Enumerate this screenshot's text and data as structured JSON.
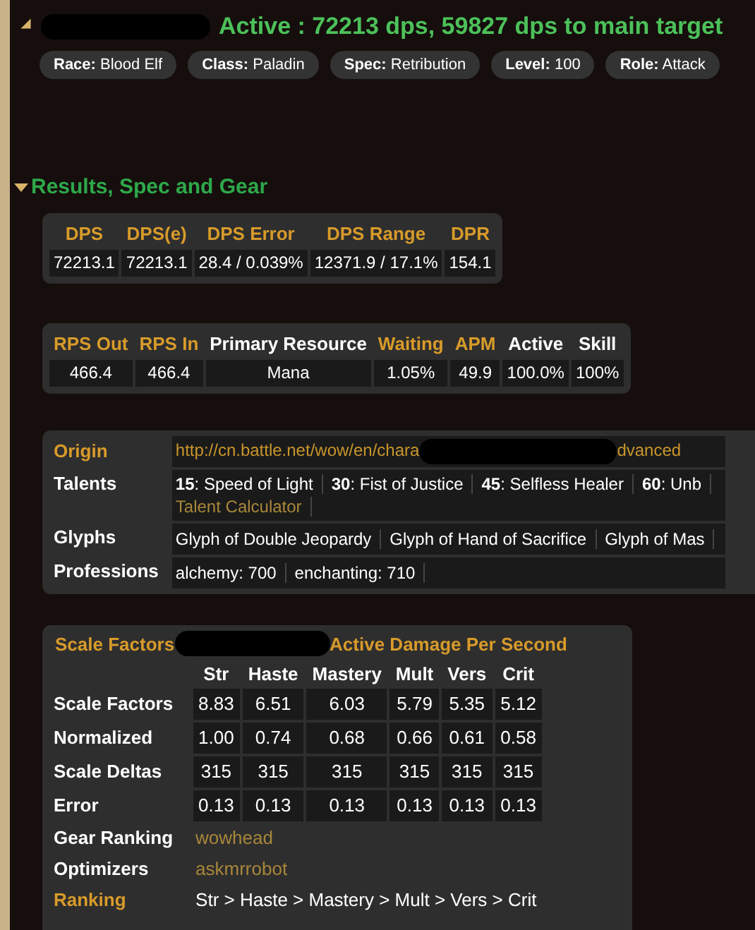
{
  "header": {
    "title": "Active : 72213 dps, 59827 dps to main target",
    "tags": [
      {
        "label": "Race:",
        "value": "Blood Elf"
      },
      {
        "label": "Class:",
        "value": "Paladin"
      },
      {
        "label": "Spec:",
        "value": "Retribution"
      },
      {
        "label": "Level:",
        "value": "100"
      },
      {
        "label": "Role:",
        "value": "Attack"
      }
    ]
  },
  "section": {
    "title": "Results, Spec and Gear",
    "expanded": true
  },
  "dps_table": {
    "columns": [
      {
        "label": "DPS",
        "kind": "metric"
      },
      {
        "label": "DPS(e)",
        "kind": "metric"
      },
      {
        "label": "DPS Error",
        "kind": "metric"
      },
      {
        "label": "DPS Range",
        "kind": "metric"
      },
      {
        "label": "DPR",
        "kind": "metric"
      }
    ],
    "values": [
      "72213.1",
      "72213.1",
      "28.4 / 0.039%",
      "12371.9 / 17.1%",
      "154.1"
    ]
  },
  "resource_table": {
    "columns": [
      {
        "label": "RPS Out",
        "kind": "metric"
      },
      {
        "label": "RPS In",
        "kind": "metric"
      },
      {
        "label": "Primary Resource",
        "kind": "plain"
      },
      {
        "label": "Waiting",
        "kind": "metric"
      },
      {
        "label": "APM",
        "kind": "metric"
      },
      {
        "label": "Active",
        "kind": "plain"
      },
      {
        "label": "Skill",
        "kind": "plain"
      }
    ],
    "values": [
      "466.4",
      "466.4",
      "Mana",
      "1.05%",
      "49.9",
      "100.0%",
      "100%"
    ]
  },
  "info": {
    "origin": {
      "label": "Origin",
      "url_start": "http://cn.battle.net/wow/en/chara",
      "url_end": "dvanced"
    },
    "talents": {
      "label": "Talents",
      "items": [
        "**15**: Speed of Light",
        "**30**: Fist of Justice",
        "**45**: Selfless Healer",
        "**60**: Unb"
      ],
      "link": "Talent Calculator"
    },
    "glyphs": {
      "label": "Glyphs",
      "items": [
        "Glyph of Double Jeopardy",
        "Glyph of Hand of Sacrifice",
        "Glyph of Mas"
      ]
    },
    "professions": {
      "label": "Professions",
      "items": [
        "alchemy: 700",
        "enchanting: 710"
      ]
    }
  },
  "scale": {
    "title_start": "Scale Factors",
    "title_end": "Active Damage Per Second",
    "columns": [
      "Str",
      "Haste",
      "Mastery",
      "Mult",
      "Vers",
      "Crit"
    ],
    "rows": [
      {
        "label": "Scale Factors",
        "values": [
          "8.83",
          "6.51",
          "6.03",
          "5.79",
          "5.35",
          "5.12"
        ]
      },
      {
        "label": "Normalized",
        "values": [
          "1.00",
          "0.74",
          "0.68",
          "0.66",
          "0.61",
          "0.58"
        ]
      },
      {
        "label": "Scale Deltas",
        "values": [
          "315",
          "315",
          "315",
          "315",
          "315",
          "315"
        ]
      },
      {
        "label": "Error",
        "values": [
          "0.13",
          "0.13",
          "0.13",
          "0.13",
          "0.13",
          "0.13"
        ]
      }
    ],
    "gear_ranking": {
      "label": "Gear Ranking",
      "link": "wowhead"
    },
    "optimizers": {
      "label": "Optimizers",
      "link": "askmrrobot"
    },
    "ranking": {
      "label": "Ranking",
      "value": "Str > Haste > Mastery > Mult > Vers > Crit"
    }
  }
}
